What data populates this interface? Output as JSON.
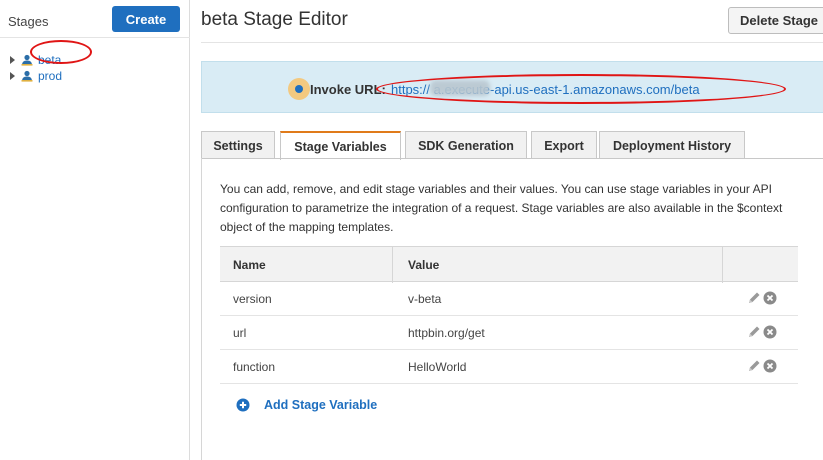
{
  "sidebar": {
    "title": "Stages",
    "create_label": "Create",
    "items": [
      {
        "label": "beta"
      },
      {
        "label": "prod"
      }
    ]
  },
  "header": {
    "title": "beta Stage Editor",
    "delete_label": "Delete Stage"
  },
  "invoke": {
    "label": "Invoke URL:",
    "url": "https://            a.execute-api.us-east-1.amazonaws.com/beta"
  },
  "tabs": [
    {
      "label": "Settings",
      "active": false
    },
    {
      "label": "Stage Variables",
      "active": true
    },
    {
      "label": "SDK Generation",
      "active": false
    },
    {
      "label": "Export",
      "active": false
    },
    {
      "label": "Deployment History",
      "active": false
    }
  ],
  "description": "You can add, remove, and edit stage variables and their values. You can use stage variables in your API configuration to parametrize the integration of a request. Stage variables are also available in the $context object of the mapping templates.",
  "table": {
    "columns": [
      "Name",
      "Value"
    ],
    "rows": [
      {
        "name": "version",
        "value": "v-beta"
      },
      {
        "name": "url",
        "value": "httpbin.org/get"
      },
      {
        "name": "function",
        "value": "HelloWorld"
      }
    ]
  },
  "add_variable_label": "Add Stage Variable",
  "colors": {
    "accent": "#1f6fbf",
    "active_tab": "#e07b1a",
    "annotation": "#e01515",
    "invoke_bg": "#d9ecf5"
  },
  "icons": {
    "stage": "user-stage-icon",
    "edit": "pencil-icon",
    "remove": "remove-circle-icon",
    "add": "plus-circle-icon"
  }
}
